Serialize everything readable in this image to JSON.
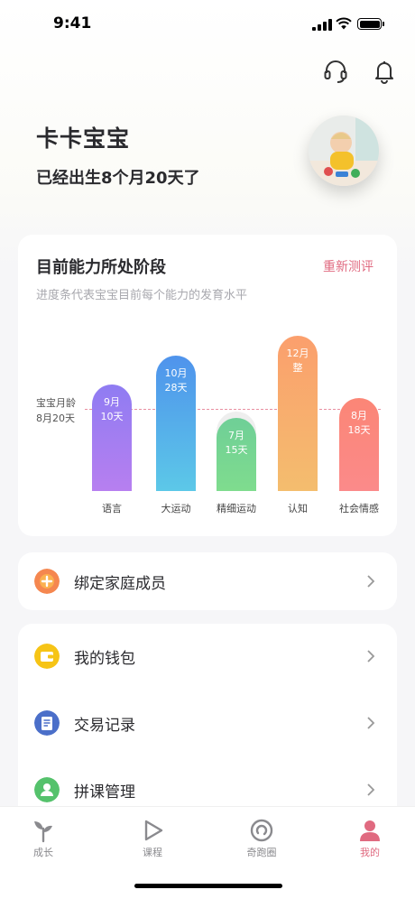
{
  "status": {
    "time": "9:41"
  },
  "header": {
    "support_icon": "headset-icon",
    "notification_icon": "bell-icon"
  },
  "profile": {
    "name": "卡卡宝宝",
    "age": "已经出生8个月20天了"
  },
  "ability": {
    "title": "目前能力所处阶段",
    "retest": "重新测评",
    "subtitle": "进度条代表宝宝目前每个能力的发育水平",
    "reference_label_1": "宝宝月龄",
    "reference_label_2": "8月20天",
    "chart_data": {
      "type": "bar",
      "reference": "8月20天",
      "categories": [
        "语言",
        "大运动",
        "精细运动",
        "认知",
        "社会情感"
      ],
      "series": [
        {
          "values_months": [
            9.33,
            10.93,
            7.5,
            12,
            8.6
          ],
          "labels": [
            [
              "9月",
              "10天"
            ],
            [
              "10月",
              "28天"
            ],
            [
              "7月",
              "15天"
            ],
            [
              "12月",
              "整"
            ],
            [
              "8月",
              "18天"
            ]
          ]
        }
      ],
      "colors": [
        [
          "#8f7cf2",
          "#b77ff0"
        ],
        [
          "#4f93ec",
          "#5cc8e8"
        ],
        [
          "#6fcf97",
          "#7fdc8e"
        ],
        [
          "#fb9f6d",
          "#f4bd6e"
        ],
        [
          "#fb8676",
          "#fb8a8a"
        ]
      ]
    }
  },
  "menu": {
    "family": {
      "label": "绑定家庭成员",
      "icon": "add-family-icon",
      "color": "#f5874f"
    },
    "wallet": {
      "label": "我的钱包",
      "icon": "wallet-icon",
      "color": "#f6c416"
    },
    "transactions": {
      "label": "交易记录",
      "icon": "receipt-icon",
      "color": "#4b6fc9"
    },
    "group": {
      "label": "拼课管理",
      "icon": "group-course-icon",
      "color": "#55c26c"
    }
  },
  "tabbar": {
    "tabs": [
      {
        "label": "成长",
        "icon": "sprout-icon"
      },
      {
        "label": "课程",
        "icon": "play-icon"
      },
      {
        "label": "奇跑圈",
        "icon": "circle-icon"
      },
      {
        "label": "我的",
        "icon": "person-icon"
      }
    ],
    "active_color": "#e06a80"
  }
}
